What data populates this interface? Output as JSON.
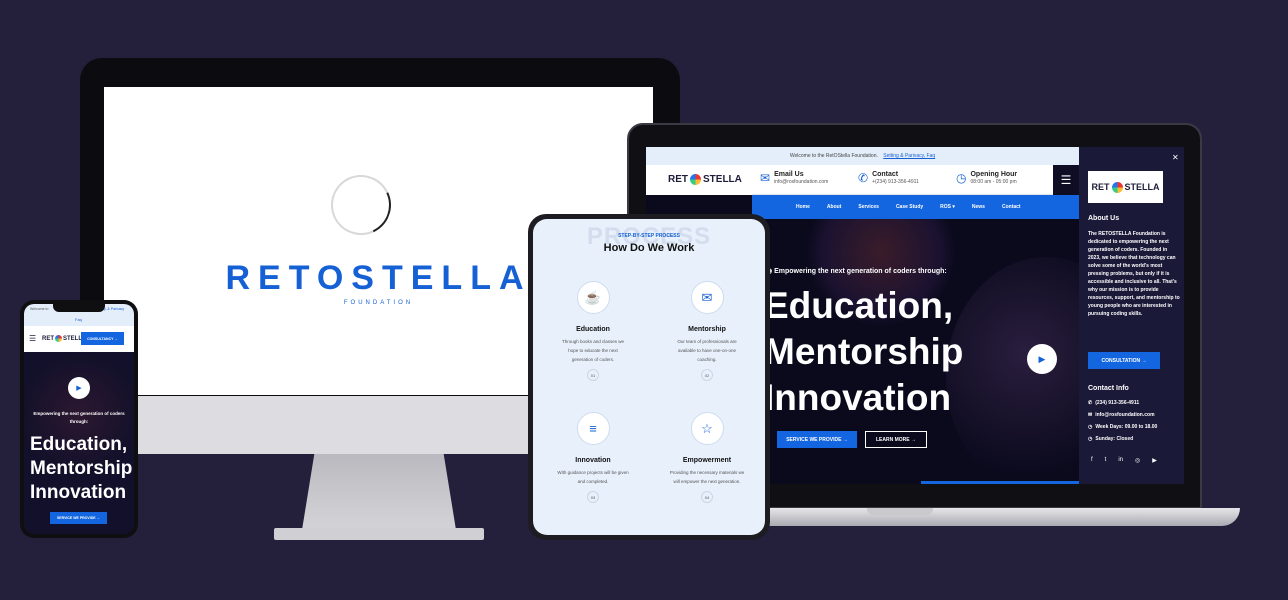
{
  "colors": {
    "background": "#241f3b",
    "brand_blue": "#1466e0",
    "dark_navy": "#0b0a1d",
    "light_bg": "#e7f0fb"
  },
  "desktop": {
    "brand": "RETOSTELLA",
    "brand_sub": "FOUNDATION"
  },
  "laptop": {
    "topbar_text": "Welcome to the RetOStella Foundation.",
    "topbar_link": "Setting & Parivacy, Faq",
    "logo_left": "RET",
    "logo_right": "STELLA",
    "email": {
      "title": "Email Us",
      "value": "info@rosfoundation.com"
    },
    "contact": {
      "title": "Contact",
      "value": "+(234) 913-356-4911"
    },
    "hours": {
      "title": "Opening Hour",
      "value": "08:00 am - 05:00 pm"
    },
    "nav": [
      "Home",
      "About",
      "Services",
      "Case Study",
      "ROS ▾",
      "News",
      "Contact"
    ],
    "hero_tagline": "Empowering the next generation of coders through:",
    "hero_lines": [
      "Education,",
      "Mentorship",
      "Innovation"
    ],
    "btn_services": "SERVICE WE PROVIDE →",
    "btn_learn": "LEARN MORE →",
    "close_label": "✕",
    "side": {
      "about_title": "About Us",
      "about_text": "The RETOSTELLA Foundation is dedicated to empowering the next generation of coders. Founded in 2023, we believe that technology can solve some of the world's most pressing problems, but only if it is accessible and inclusive to all. That's why our mission is to provide resources, support, and mentorship to young people who are interested in pursuing coding skills.",
      "consult_btn": "CONSULTATION →",
      "contact_title": "Contact Info",
      "phone": "(234) 913-356-4911",
      "email": "info@rosfoundation.com",
      "weekdays": "Week Days: 09.00 to 18.00",
      "sunday": "Sunday: Closed",
      "social": [
        "f",
        "t",
        "in",
        "◎",
        "▶"
      ]
    }
  },
  "tablet": {
    "ghost": "PROCESS",
    "step_label": "STEP-BY-STEP PROCESS",
    "title": "How Do We Work",
    "services": [
      {
        "icon": "☕",
        "title": "Education",
        "desc": "Through books and classes we hope to educate the next generation of coders.",
        "num": "01"
      },
      {
        "icon": "✉",
        "title": "Mentorship",
        "desc": "Our team of professionals are available to have one-on-one coaching.",
        "num": "02"
      },
      {
        "icon": "≡",
        "title": "Innovation",
        "desc": "With guidance projects will be given and completed.",
        "num": "03"
      },
      {
        "icon": "☆",
        "title": "Empowerment",
        "desc": "Providing the necessary materials we will empower the next generation.",
        "num": "04"
      }
    ]
  },
  "phone": {
    "strip_left": "Welcome to",
    "strip_right": "y, & Parivacy",
    "strip_faq": "Faq",
    "logo_left": "RET",
    "logo_right": "STELLA",
    "consult_btn": "CONSULTANCY →",
    "tagline": "Empowering the next generation of coders through:",
    "hero_lines": [
      "Education,",
      "Mentorship",
      "Innovation"
    ],
    "btn_services": "SERVICE WE PROVIDE →"
  }
}
